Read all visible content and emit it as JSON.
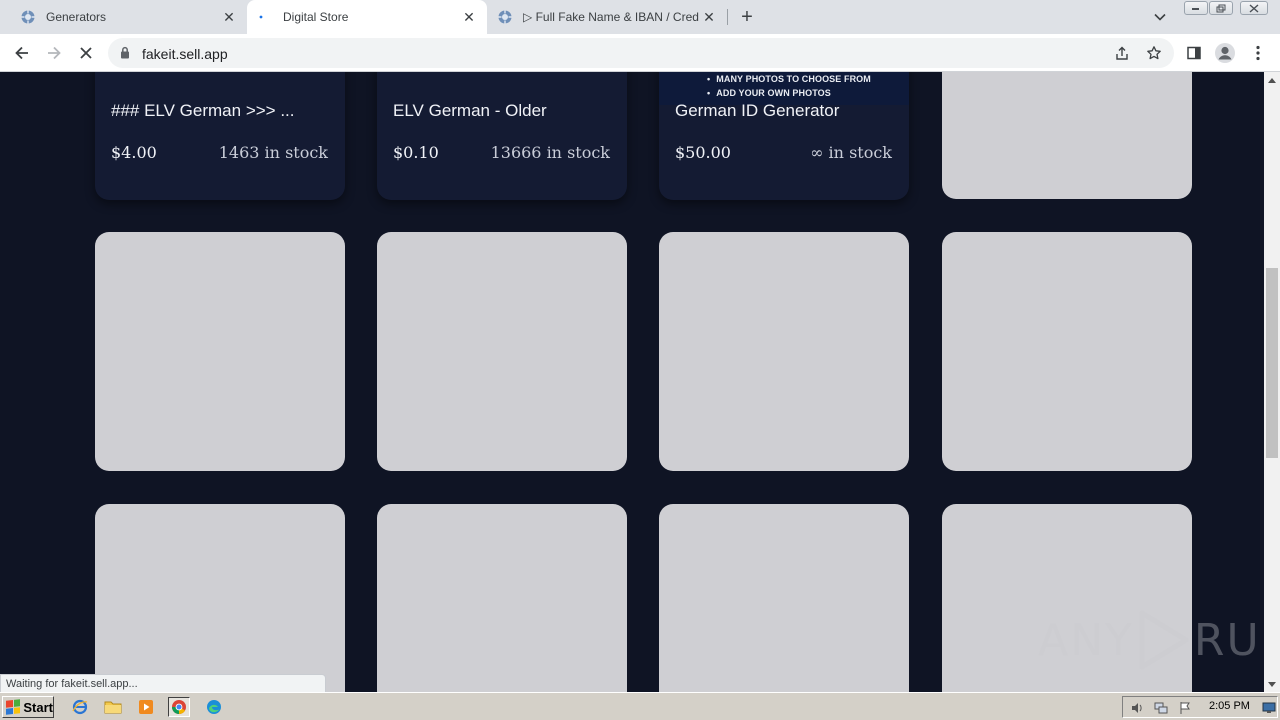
{
  "browser": {
    "tabs": [
      {
        "title": "Generators",
        "icon": "generators-site-icon",
        "active": false
      },
      {
        "title": "Digital Store",
        "icon": "loading-spinner-icon",
        "active": true
      },
      {
        "title": "▷ Full Fake Name & IBAN / Credit Ca",
        "icon": "fake-name-site-icon",
        "active": false
      }
    ],
    "close_glyph": "✕",
    "new_tab_glyph": "+",
    "url": "fakeit.sell.app",
    "status_text": "Waiting for fakeit.sell.app...",
    "accent_color": "#1a73e8"
  },
  "store": {
    "products": [
      {
        "name": "### ELV German >>> ...",
        "price": "$4.00",
        "stock": "1463 in stock"
      },
      {
        "name": "ELV German - Older",
        "price": "$0.10",
        "stock": "13666 in stock"
      },
      {
        "name": "German ID Generator",
        "price": "$50.00",
        "stock": "∞ in stock",
        "banner_lines": [
          "MANY PHOTOS TO CHOOSE FROM",
          "ADD YOUR OWN PHOTOS"
        ]
      }
    ],
    "background_color": "#0f1424",
    "card_color": "#141b33",
    "placeholder_color": "#cfcfd3"
  },
  "watermark": {
    "text_left": "ANY",
    "text_right": "RUN"
  },
  "taskbar": {
    "start_label": "Start",
    "clock": "2:05 PM",
    "quick_launch": [
      "internet-explorer-icon",
      "folder-icon",
      "media-player-icon",
      "chrome-icon",
      "edge-icon"
    ]
  }
}
